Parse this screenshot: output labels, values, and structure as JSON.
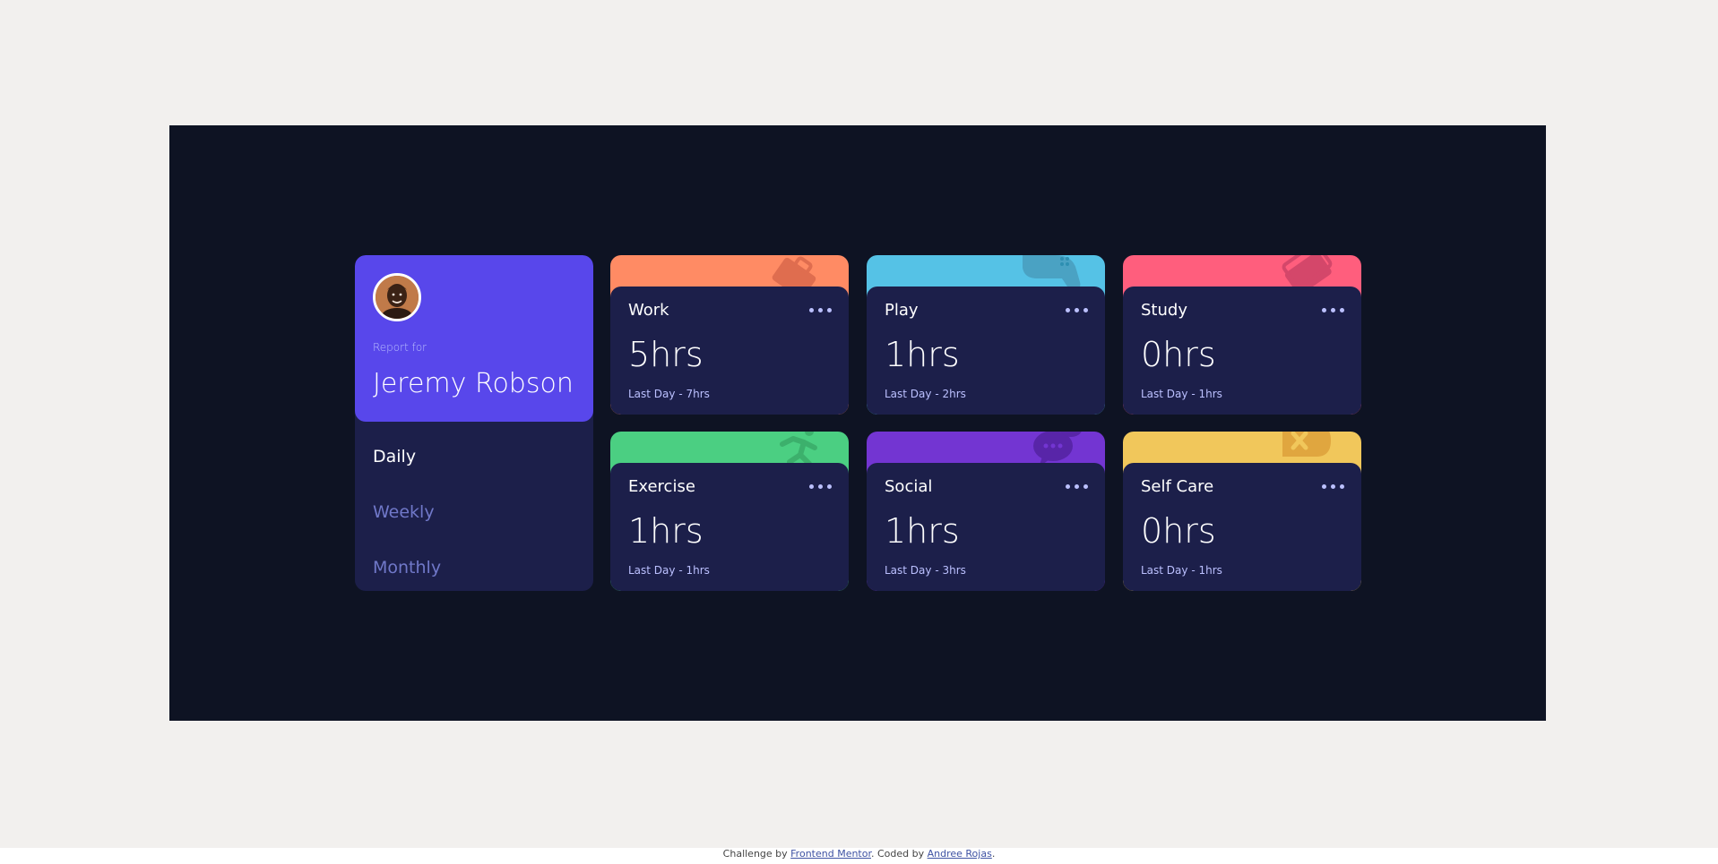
{
  "profile": {
    "report_for": "Report for",
    "name": "Jeremy Robson",
    "avatar_icon": "avatar-photo"
  },
  "periods": [
    {
      "label": "Daily",
      "active": true
    },
    {
      "label": "Weekly",
      "active": false
    },
    {
      "label": "Monthly",
      "active": false
    }
  ],
  "cards": [
    {
      "title": "Work",
      "current": "5hrs",
      "previous": "Last Day - 7hrs",
      "color": "#ff8b64",
      "icon": "briefcase-icon"
    },
    {
      "title": "Play",
      "current": "1hrs",
      "previous": "Last Day - 2hrs",
      "color": "#55c2e6",
      "icon": "gamepad-icon"
    },
    {
      "title": "Study",
      "current": "0hrs",
      "previous": "Last Day - 1hrs",
      "color": "#ff5e7d",
      "icon": "books-icon"
    },
    {
      "title": "Exercise",
      "current": "1hrs",
      "previous": "Last Day - 1hrs",
      "color": "#4bcf82",
      "icon": "running-icon"
    },
    {
      "title": "Social",
      "current": "1hrs",
      "previous": "Last Day - 3hrs",
      "color": "#7335d2",
      "icon": "chat-icon"
    },
    {
      "title": "Self Care",
      "current": "0hrs",
      "previous": "Last Day - 1hrs",
      "color": "#f1c75b",
      "icon": "heart-care-icon"
    }
  ],
  "footer": {
    "prefix": "Challenge by ",
    "challenge_link": "Frontend Mentor",
    "middle": ". Coded by ",
    "author_link": "Andree Rojas",
    "suffix": "."
  },
  "colors": {
    "page_background": "#f2f0ee",
    "frame_background": "#0e1323",
    "card_background": "#1c1f4a",
    "profile_accent": "#5847eb",
    "muted_text": "#bbc0ff",
    "inactive_period": "#7078c9"
  }
}
